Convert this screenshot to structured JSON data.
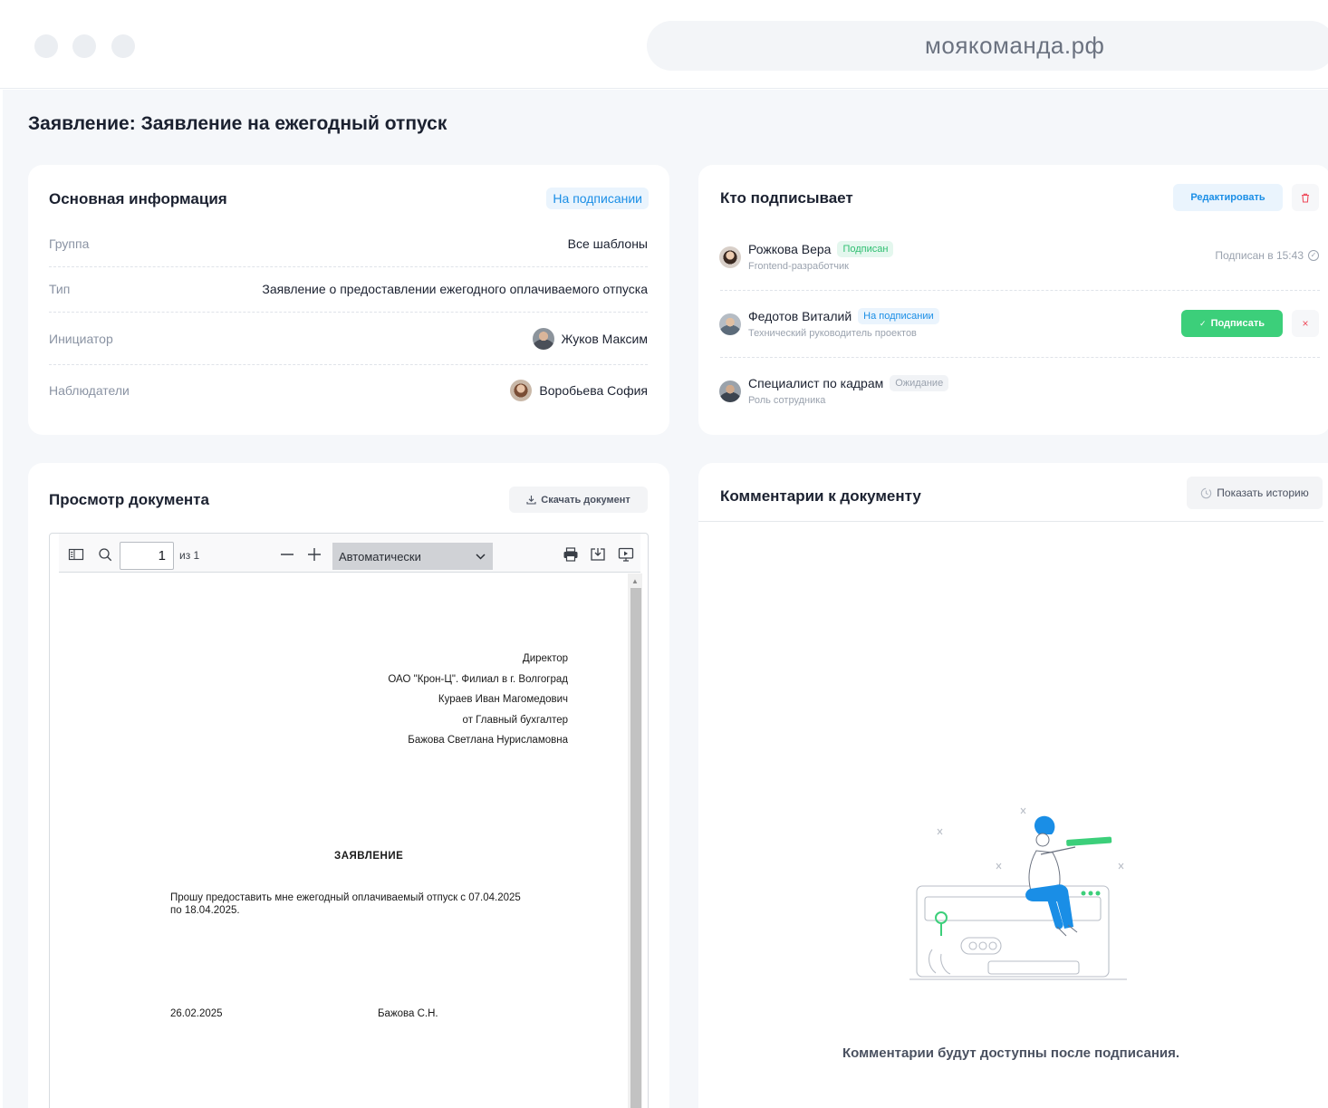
{
  "browser": {
    "url": "моякоманда.рф"
  },
  "page": {
    "title": "Заявление: Заявление на ежегодный отпуск"
  },
  "info": {
    "title": "Основная информация",
    "status": "На подписании",
    "rows": [
      {
        "label": "Группа",
        "value": "Все шаблоны"
      },
      {
        "label": "Тип",
        "value": "Заявление о предоставлении ежегодного оплачиваемого отпуска"
      },
      {
        "label": "Инициатор",
        "value": "Жуков Максим"
      },
      {
        "label": "Наблюдатели",
        "value": "Воробьева София"
      }
    ]
  },
  "signers": {
    "title": "Кто подписывает",
    "edit_label": "Редактировать",
    "items": [
      {
        "name": "Рожкова Вера",
        "status": "Подписан",
        "role": "Frontend-разработчик",
        "signed_at": "Подписан в 15:43"
      },
      {
        "name": "Федотов Виталий",
        "status": "На подписании",
        "role": "Технический руководитель проектов",
        "sign_label": "Подписать"
      },
      {
        "name": "Специалист по кадрам",
        "status": "Ожидание",
        "role": "Роль сотрудника"
      }
    ]
  },
  "document": {
    "title": "Просмотр документа",
    "download_label": "Скачать документ",
    "viewer": {
      "page": "1",
      "page_of": "из 1",
      "zoom": "Автоматически"
    },
    "header_lines": [
      "Директор",
      "ОАО \"Крон-Ц\". Филиал в г. Волгоград",
      "Кураев Иван Магомедович",
      "от Главный бухгалтер",
      "Бажова Светлана Нурисламовна"
    ],
    "heading": "ЗАЯВЛЕНИЕ",
    "body_line1": "Прошу предоставить мне ежегодный оплачиваемый отпуск с 07.04.2025",
    "body_line2": "по 18.04.2025.",
    "date": "26.02.2025",
    "signature": "Бажова С.Н."
  },
  "comments": {
    "title": "Комментарии к документу",
    "history_label": "Показать историю",
    "empty_text": "Комментарии будут доступны после подписания."
  },
  "colors": {
    "accent": "#1a8ee6",
    "success": "#3ccf7a",
    "danger": "#ef4b5c",
    "background": "#f5f7fa"
  },
  "icons": [
    "sidebar-toggle-icon",
    "search-icon",
    "minus-icon",
    "plus-icon",
    "chevron-down-icon",
    "print-icon",
    "save-icon",
    "presentation-icon",
    "trash-icon",
    "close-icon",
    "check-icon",
    "clock-icon",
    "download-icon"
  ]
}
